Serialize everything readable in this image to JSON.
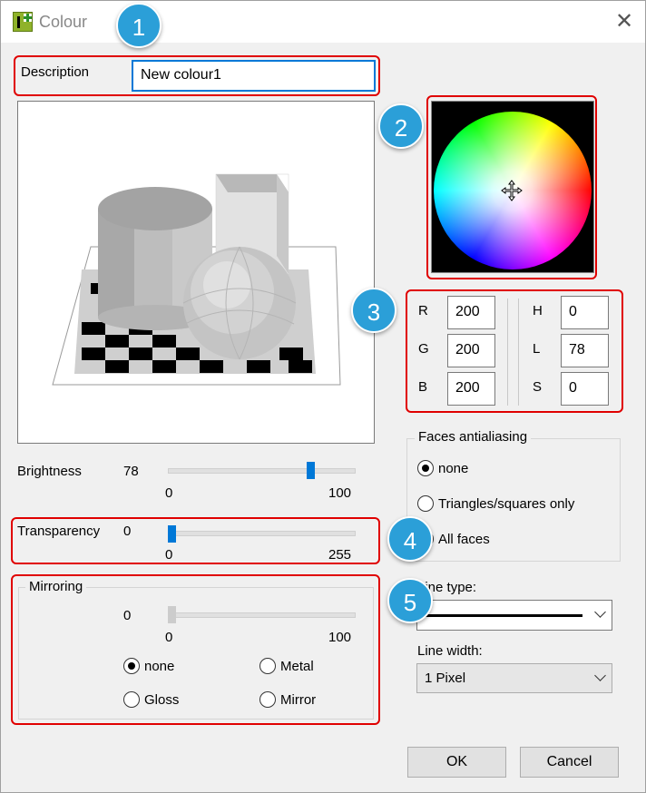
{
  "window": {
    "title": "Colour",
    "close_glyph": "✕"
  },
  "callouts": [
    "1",
    "2",
    "3",
    "4",
    "5"
  ],
  "description": {
    "label": "Description",
    "value": "New colour1"
  },
  "rgb": {
    "r_label": "R",
    "r_value": "200",
    "g_label": "G",
    "g_value": "200",
    "b_label": "B",
    "b_value": "200"
  },
  "hls": {
    "h_label": "H",
    "h_value": "0",
    "l_label": "L",
    "l_value": "78",
    "s_label": "S",
    "s_value": "0"
  },
  "brightness": {
    "label": "Brightness",
    "value": "78",
    "min": "0",
    "max": "100",
    "level": 0.78
  },
  "transparency": {
    "label": "Transparency",
    "value": "0",
    "min": "0",
    "max": "255",
    "level": 0
  },
  "mirroring": {
    "title": "Mirroring",
    "value": "0",
    "min": "0",
    "max": "100",
    "level": 0,
    "options": [
      "none",
      "Metal",
      "Gloss",
      "Mirror"
    ],
    "selected": "none"
  },
  "faces_antialiasing": {
    "title": "Faces antialiasing",
    "options": [
      "none",
      "Triangles/squares only",
      "All faces"
    ],
    "selected": "none"
  },
  "line_type": {
    "label": "Line type:"
  },
  "line_width": {
    "label": "Line width:",
    "value": "1 Pixel"
  },
  "buttons": {
    "ok": "OK",
    "cancel": "Cancel"
  },
  "colors": {
    "accent": "#0078d7",
    "callout": "#2b9fd8",
    "highlight": "#e00000"
  }
}
